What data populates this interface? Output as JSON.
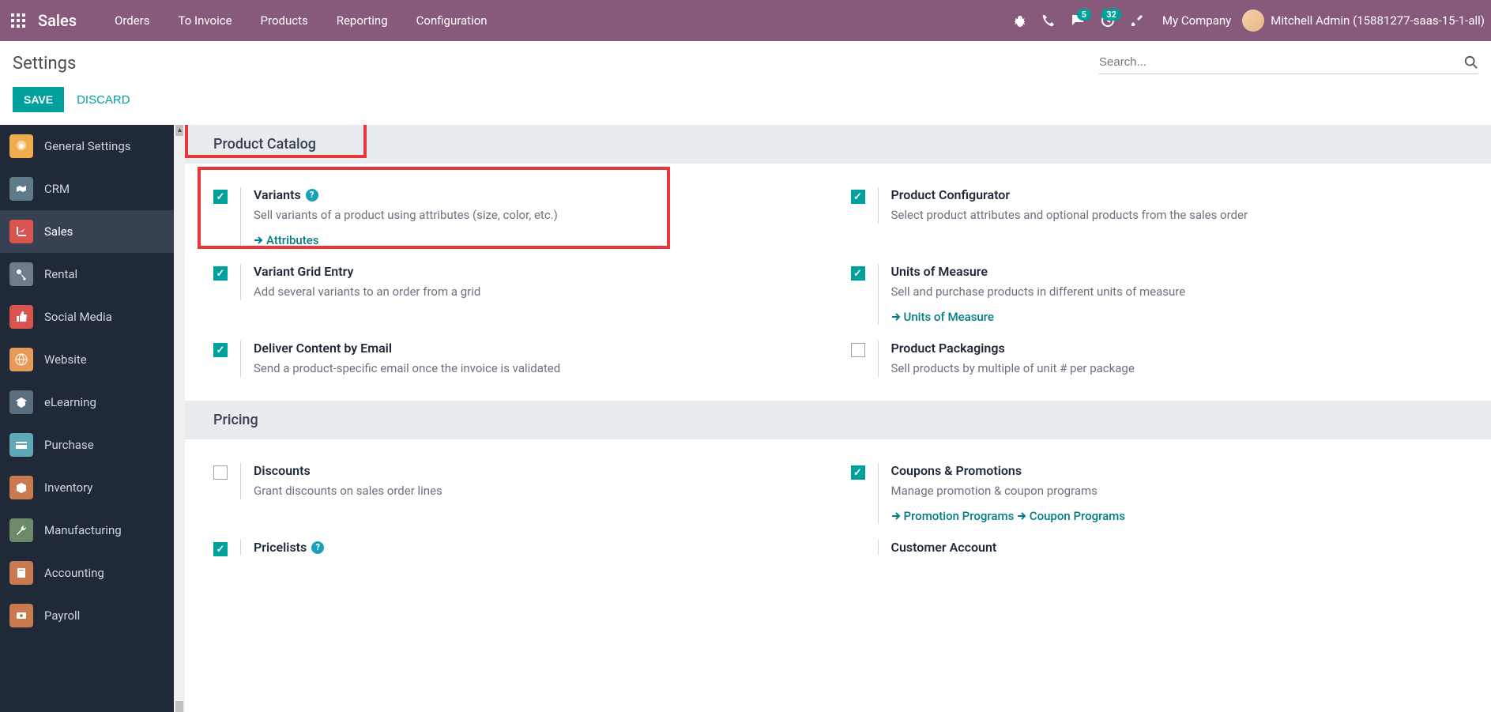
{
  "topbar": {
    "brand": "Sales",
    "menu": [
      "Orders",
      "To Invoice",
      "Products",
      "Reporting",
      "Configuration"
    ],
    "msg_badge": "5",
    "activity_badge": "32",
    "company": "My Company",
    "user": "Mitchell Admin (15881277-saas-15-1-all)"
  },
  "subheader": {
    "title": "Settings",
    "search_placeholder": "Search..."
  },
  "actions": {
    "save": "SAVE",
    "discard": "DISCARD"
  },
  "sidebar": [
    {
      "label": "General Settings",
      "color": "#f0ad4e"
    },
    {
      "label": "CRM",
      "color": "#5f7b8a"
    },
    {
      "label": "Sales",
      "color": "#d9534f",
      "active": true
    },
    {
      "label": "Rental",
      "color": "#6f7b8a"
    },
    {
      "label": "Social Media",
      "color": "#d9534f"
    },
    {
      "label": "Website",
      "color": "#e69b5a"
    },
    {
      "label": "eLearning",
      "color": "#5b6e7f"
    },
    {
      "label": "Purchase",
      "color": "#5fa8b8"
    },
    {
      "label": "Inventory",
      "color": "#c97a50"
    },
    {
      "label": "Manufacturing",
      "color": "#6a8a6a"
    },
    {
      "label": "Accounting",
      "color": "#c97a50"
    },
    {
      "label": "Payroll",
      "color": "#c97a50"
    }
  ],
  "sections": {
    "product_catalog": {
      "title": "Product Catalog",
      "items": [
        {
          "title": "Variants",
          "desc": "Sell variants of a product using attributes (size, color, etc.)",
          "checked": true,
          "help": true,
          "links": [
            "Attributes"
          ]
        },
        {
          "title": "Product Configurator",
          "desc": "Select product attributes and optional products from the sales order",
          "checked": true
        },
        {
          "title": "Variant Grid Entry",
          "desc": "Add several variants to an order from a grid",
          "checked": true
        },
        {
          "title": "Units of Measure",
          "desc": "Sell and purchase products in different units of measure",
          "checked": true,
          "links": [
            "Units of Measure"
          ]
        },
        {
          "title": "Deliver Content by Email",
          "desc": "Send a product-specific email once the invoice is validated",
          "checked": true
        },
        {
          "title": "Product Packagings",
          "desc": "Sell products by multiple of unit # per package",
          "checked": false
        }
      ]
    },
    "pricing": {
      "title": "Pricing",
      "items": [
        {
          "title": "Discounts",
          "desc": "Grant discounts on sales order lines",
          "checked": false
        },
        {
          "title": "Coupons & Promotions",
          "desc": "Manage promotion & coupon programs",
          "checked": true,
          "links": [
            "Promotion Programs",
            "Coupon Programs"
          ]
        },
        {
          "title": "Pricelists",
          "desc": "",
          "checked": true,
          "help": true
        },
        {
          "title": "Customer Account",
          "desc": "",
          "checked": false,
          "nocheck": true
        }
      ]
    }
  }
}
